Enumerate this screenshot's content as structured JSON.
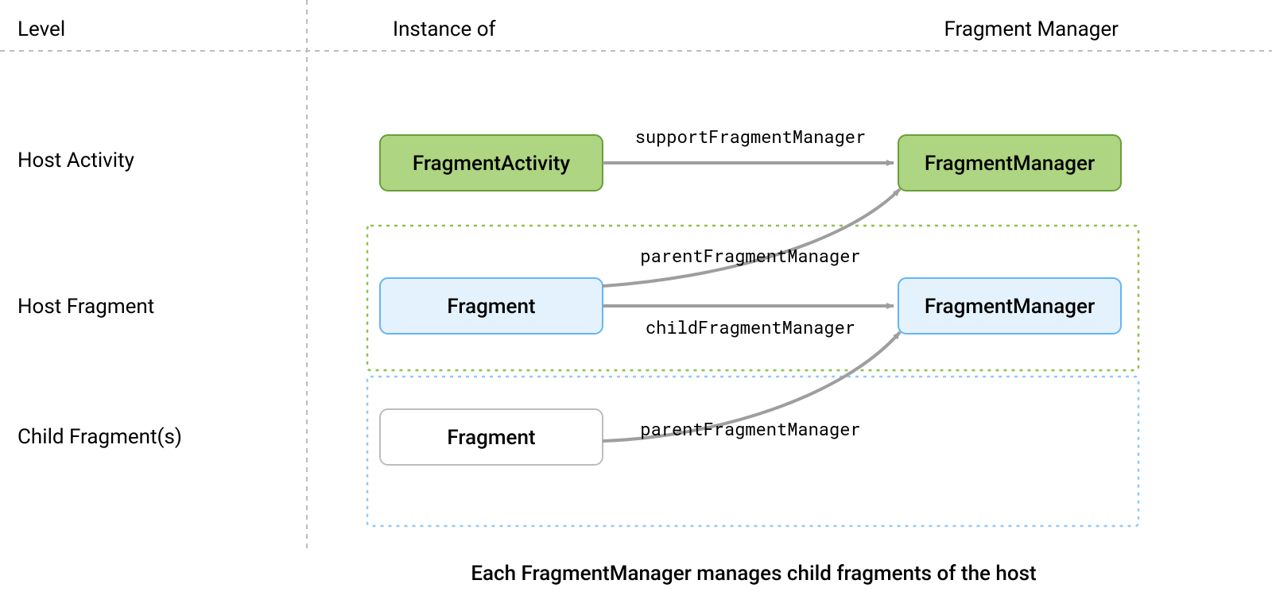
{
  "headers": {
    "level": "Level",
    "instance": "Instance of",
    "fm": "Fragment Manager"
  },
  "levels": {
    "host_activity": "Host Activity",
    "host_fragment": "Host Fragment",
    "child_fragments": "Child Fragment(s)"
  },
  "boxes": {
    "fragment_activity": "FragmentActivity",
    "fragment_host": "Fragment",
    "fragment_child": "Fragment",
    "fm_activity": "FragmentManager",
    "fm_fragment": "FragmentManager"
  },
  "edges": {
    "support_fm": "supportFragmentManager",
    "parent_fm_host": "parentFragmentManager",
    "child_fm": "childFragmentManager",
    "parent_fm_child": "parentFragmentManager"
  },
  "caption": "Each FragmentManager manages child fragments of the host",
  "colors": {
    "green_fill": "#aed581",
    "green_stroke": "#689f38",
    "blue_fill": "#e3f2fd",
    "blue_stroke": "#90caf9",
    "blue_stroke_dark": "#64b5f6",
    "white_fill": "#ffffff",
    "white_stroke": "#bdbdbd",
    "arrow": "#9e9e9e",
    "dashed": "#bdbdbd"
  }
}
